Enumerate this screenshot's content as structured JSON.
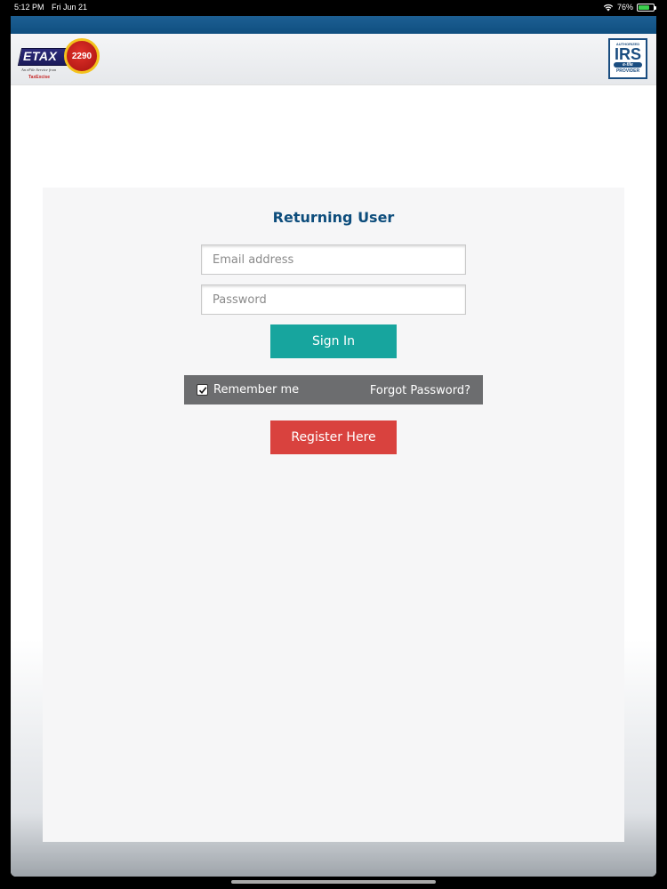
{
  "status_bar": {
    "time": "5:12 PM",
    "date": "Fri Jun 21",
    "battery": "76%",
    "battery_level": 0.76
  },
  "header": {
    "logo": {
      "brand": "ETAX",
      "number": "2290",
      "tagline": "An eFile Service from",
      "sub": "TaxExcise"
    },
    "irs_badge": {
      "line1": "AUTHORIZED",
      "line2": "IRS",
      "line3": "e-file",
      "line4": "PROVIDER"
    }
  },
  "login": {
    "title": "Returning User",
    "email_placeholder": "Email address",
    "email_value": "",
    "password_placeholder": "Password",
    "password_value": "",
    "signin_label": "Sign In",
    "remember_label": "Remember me",
    "remember_checked": true,
    "forgot_label": "Forgot Password?",
    "register_label": "Register Here"
  },
  "colors": {
    "accent_blue": "#0d4d7c",
    "signin_teal": "#17a59e",
    "register_red": "#d9423e",
    "remember_gray": "#6c6d6f"
  }
}
